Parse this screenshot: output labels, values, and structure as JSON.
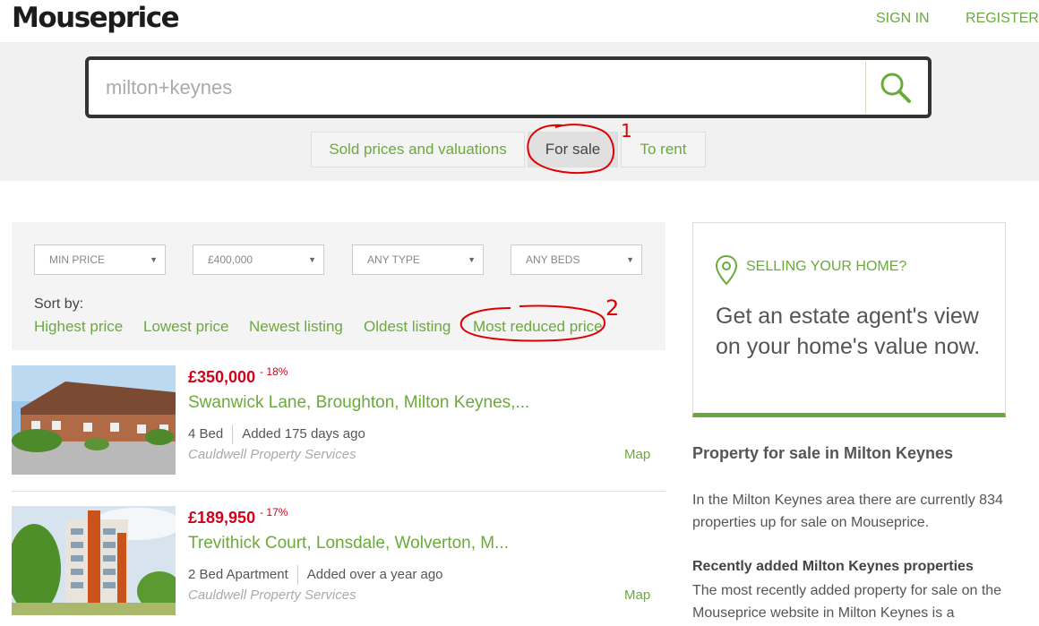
{
  "header": {
    "logo": "Mouseprice",
    "sign_in": "SIGN IN",
    "register": "REGISTER"
  },
  "search": {
    "value": "milton+keynes",
    "icon": "search-icon"
  },
  "tabs": [
    {
      "label": "Sold prices and valuations"
    },
    {
      "label": "For sale",
      "active": true
    },
    {
      "label": "To rent"
    }
  ],
  "filters": {
    "min_price": "MIN PRICE",
    "max_price": "£400,000",
    "type": "ANY TYPE",
    "beds": "ANY BEDS"
  },
  "sort": {
    "label": "Sort by:",
    "options": [
      "Highest price",
      "Lowest price",
      "Newest listing",
      "Oldest listing",
      "Most reduced price"
    ]
  },
  "listings": [
    {
      "price": "£350,000",
      "reduction": "- 18%",
      "address": "Swanwick Lane, Broughton, Milton Keynes,...",
      "beds": "4 Bed",
      "added": "Added 175 days ago",
      "agent": "Cauldwell Property Services",
      "map": "Map"
    },
    {
      "price": "£189,950",
      "reduction": "- 17%",
      "address": "Trevithick Court, Lonsdale, Wolverton, M...",
      "beds": "2 Bed Apartment",
      "added": "Added over a year ago",
      "agent": "Cauldwell Property Services",
      "map": "Map"
    }
  ],
  "promo": {
    "heading": "SELLING YOUR HOME?",
    "body": "Get an estate agent's view on your home's value now."
  },
  "sidebar": {
    "heading": "Property for sale in Milton Keynes",
    "paragraph": "In the Milton Keynes area there are currently 834 properties up for sale on Mouseprice.",
    "recent_heading": "Recently added Milton Keynes properties",
    "recent_text": "The most recently added property for sale on the Mouseprice website in Milton Keynes is a"
  },
  "annotations": {
    "one": "1",
    "two": "2"
  },
  "colors": {
    "accent": "#6aaa3a",
    "price": "#d0021b",
    "annotation": "#e00000"
  }
}
